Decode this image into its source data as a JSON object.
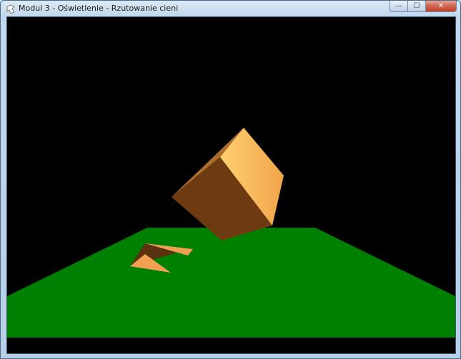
{
  "window": {
    "title": "Modul 3 - Oświetlenie - Rzutowanie cieni",
    "controls": {
      "minimize_glyph": "—",
      "maximize_glyph": "☐",
      "close_glyph": "✕"
    }
  },
  "icons": {
    "app": "opengl-app-icon"
  },
  "scene": {
    "background_color": "#000000",
    "floor_color": "#008000",
    "cube_light_color": "#ffd070",
    "cube_mid_color": "#f2a44a",
    "cube_dark_color": "#6e3a12",
    "shadow_dark_color": "#5a3210",
    "shadow_light_color": "#f0a050"
  }
}
